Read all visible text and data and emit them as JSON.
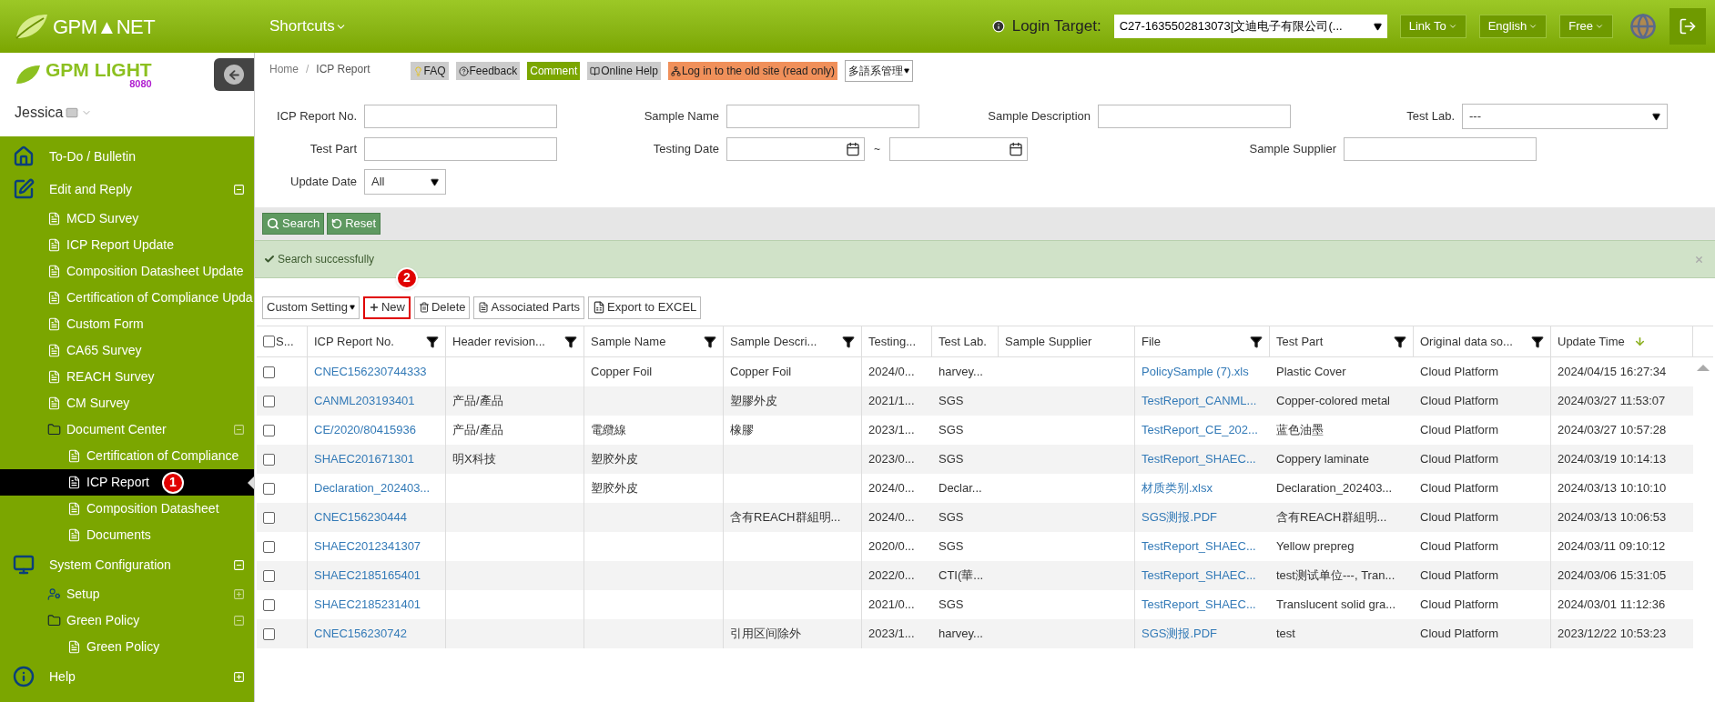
{
  "topbar": {
    "logo": "GPM▲NET",
    "shortcuts": "Shortcuts",
    "login_label": "Login Target:",
    "login_value": "C27-1635502813073[文迪电子有限公司(...",
    "menus": [
      "Link To",
      "English",
      "Free"
    ]
  },
  "sidebar": {
    "logo": "GPM LIGHT",
    "logo_sub": "8080",
    "user": "Jessica",
    "items": [
      {
        "kind": "home",
        "label": "To-Do / Bulletin",
        "selected": false
      },
      {
        "kind": "edit",
        "label": "Edit and Reply",
        "selected": false,
        "expanded": true,
        "children": [
          {
            "kind": "file",
            "label": "MCD Survey",
            "selected": false
          },
          {
            "kind": "file",
            "label": "ICP Report Update",
            "selected": false
          },
          {
            "kind": "file",
            "label": "Composition Datasheet Update",
            "selected": false
          },
          {
            "kind": "file",
            "label": "Certification of Compliance Upda",
            "selected": false
          },
          {
            "kind": "file",
            "label": "Custom Form",
            "selected": false
          },
          {
            "kind": "file",
            "label": "CA65 Survey",
            "selected": false
          },
          {
            "kind": "file",
            "label": "REACH Survey",
            "selected": false
          },
          {
            "kind": "file",
            "label": "CM Survey",
            "selected": false
          },
          {
            "kind": "folder",
            "label": "Document Center",
            "selected": false,
            "expanded": true,
            "children": [
              {
                "kind": "file",
                "label": "Certification of Compliance",
                "selected": false
              },
              {
                "kind": "file",
                "label": "ICP Report",
                "selected": true,
                "badge": "1"
              },
              {
                "kind": "file",
                "label": "Composition Datasheet",
                "selected": false
              },
              {
                "kind": "file",
                "label": "Documents",
                "selected": false
              }
            ]
          }
        ]
      },
      {
        "kind": "monitor",
        "label": "System Configuration",
        "selected": false,
        "expanded": true,
        "children": [
          {
            "kind": "user",
            "label": "Setup",
            "selected": false,
            "expanded": false
          },
          {
            "kind": "folder",
            "label": "Green Policy",
            "selected": false,
            "expanded": true,
            "children": [
              {
                "kind": "file",
                "label": "Green Policy",
                "selected": false
              }
            ]
          }
        ]
      },
      {
        "kind": "info",
        "label": "Help",
        "selected": false,
        "expanded": false
      }
    ]
  },
  "breadcrumb": {
    "items": [
      "Home",
      "ICP Report"
    ],
    "separator": "/"
  },
  "header_buttons": [
    {
      "kind": "bulb",
      "label": "FAQ",
      "color": "#cccccc"
    },
    {
      "kind": "question",
      "label": "Feedback",
      "color": "#cccccc"
    },
    {
      "kind": "plain",
      "label": "Comment",
      "color": "#7ba600"
    },
    {
      "kind": "book",
      "label": "Online Help",
      "color": "#cccccc"
    },
    {
      "kind": "sitemap",
      "label": "Log in to the old site (read only)",
      "color": "#f0905a"
    },
    {
      "kind": "dropdown",
      "label": "多語系管理",
      "color": "#ffffff"
    }
  ],
  "filters": [
    [
      {
        "kind": "text",
        "label": "ICP Report No."
      },
      {
        "kind": "text",
        "label": "Sample Name"
      },
      {
        "kind": "text",
        "label": "Sample Description"
      },
      {
        "kind": "select",
        "label": "Test Lab.",
        "value": "---"
      }
    ],
    [
      {
        "kind": "text",
        "label": "Test Part"
      },
      {
        "kind": "daterange",
        "label": "Testing Date",
        "separator": "~"
      },
      {
        "kind": "text",
        "label": "Sample Supplier"
      }
    ],
    [
      {
        "kind": "select",
        "label": "Update Date",
        "value": "All"
      }
    ]
  ],
  "search_buttons": [
    {
      "kind": "search",
      "label": "Search"
    },
    {
      "kind": "reset",
      "label": "Reset"
    }
  ],
  "alert": "Search successfully",
  "toolbar": [
    {
      "kind": "dropdown",
      "label": "Custom Setting",
      "highlighted": false
    },
    {
      "kind": "plus",
      "label": "New",
      "highlighted": true,
      "badge": "2"
    },
    {
      "kind": "trash",
      "label": "Delete",
      "highlighted": false
    },
    {
      "kind": "doc",
      "label": "Associated Parts",
      "highlighted": false
    },
    {
      "kind": "excel",
      "label": "Export to EXCEL",
      "highlighted": false
    }
  ],
  "table": {
    "columns": [
      {
        "label": "S...",
        "filter": false
      },
      {
        "label": "ICP Report No.",
        "filter": true
      },
      {
        "label": "Header revision...",
        "filter": true
      },
      {
        "label": "Sample Name",
        "filter": true
      },
      {
        "label": "Sample Descri...",
        "filter": true
      },
      {
        "label": "Testing...",
        "filter": false
      },
      {
        "label": "Test Lab.",
        "filter": false
      },
      {
        "label": "Sample Supplier",
        "filter": false
      },
      {
        "label": "File",
        "filter": true
      },
      {
        "label": "Test Part",
        "filter": true
      },
      {
        "label": "Original data so...",
        "filter": true
      },
      {
        "label": "Update Time",
        "filter": false,
        "sorted": true
      }
    ],
    "rows": [
      {
        "checked": false,
        "cells": [
          "",
          "CNEC156230744333",
          "",
          "Copper Foil",
          "Copper Foil",
          "2024/0...",
          "harvey...",
          "",
          "PolicySample (7).xls",
          "Plastic Cover",
          "Cloud Platform",
          "2024/04/15 16:27:34"
        ]
      },
      {
        "checked": false,
        "cells": [
          "",
          "CANML203193401",
          "产品/產品",
          "",
          "塑膠外皮",
          "2021/1...",
          "SGS",
          "",
          "TestReport_CANML...",
          "Copper-colored metal",
          "Cloud Platform",
          "2024/03/27 11:53:07"
        ]
      },
      {
        "checked": false,
        "cells": [
          "",
          "CE/2020/80415936",
          "产品/產品",
          "電纜線",
          "橡膠",
          "2023/1...",
          "SGS",
          "",
          "TestReport_CE_202...",
          "蓝色油墨",
          "Cloud Platform",
          "2024/03/27 10:57:28"
        ]
      },
      {
        "checked": false,
        "cells": [
          "",
          "SHAEC201671301",
          "明X科技",
          "塑胶外皮",
          "",
          "2023/0...",
          "SGS",
          "",
          "TestReport_SHAEC...",
          "Coppery laminate",
          "Cloud Platform",
          "2024/03/19 10:14:13"
        ]
      },
      {
        "checked": false,
        "cells": [
          "",
          "Declaration_202403...",
          "",
          "塑胶外皮",
          "",
          "2024/0...",
          "Declar...",
          "",
          "材质类别.xlsx",
          "Declaration_202403...",
          "Cloud Platform",
          "2024/03/13 10:10:10"
        ]
      },
      {
        "checked": false,
        "cells": [
          "",
          "CNEC156230444",
          "",
          "",
          "含有REACH群組明...",
          "2024/0...",
          "SGS",
          "",
          "SGS测报.PDF",
          "含有REACH群組明...",
          "Cloud Platform",
          "2024/03/13 10:06:53"
        ]
      },
      {
        "checked": false,
        "cells": [
          "",
          "SHAEC2012341307",
          "",
          "",
          "",
          "2020/0...",
          "SGS",
          "",
          "TestReport_SHAEC...",
          "Yellow prepreg",
          "Cloud Platform",
          "2024/03/11 09:10:12"
        ]
      },
      {
        "checked": false,
        "cells": [
          "",
          "SHAEC2185165401",
          "",
          "",
          "",
          "2022/0...",
          "CTI(華...",
          "",
          "TestReport_SHAEC...",
          "test测试单位---, Tran...",
          "Cloud Platform",
          "2024/03/06 15:31:05"
        ]
      },
      {
        "checked": false,
        "cells": [
          "",
          "SHAEC2185231401",
          "",
          "",
          "",
          "2021/0...",
          "SGS",
          "",
          "TestReport_SHAEC...",
          "Translucent solid gra...",
          "Cloud Platform",
          "2024/03/01 11:12:36"
        ]
      },
      {
        "checked": false,
        "cells": [
          "",
          "CNEC156230742",
          "",
          "",
          "引用区间除外",
          "2023/1...",
          "harvey...",
          "",
          "SGS测报.PDF",
          "test",
          "Cloud Platform",
          "2023/12/22 10:53:23"
        ]
      }
    ]
  }
}
